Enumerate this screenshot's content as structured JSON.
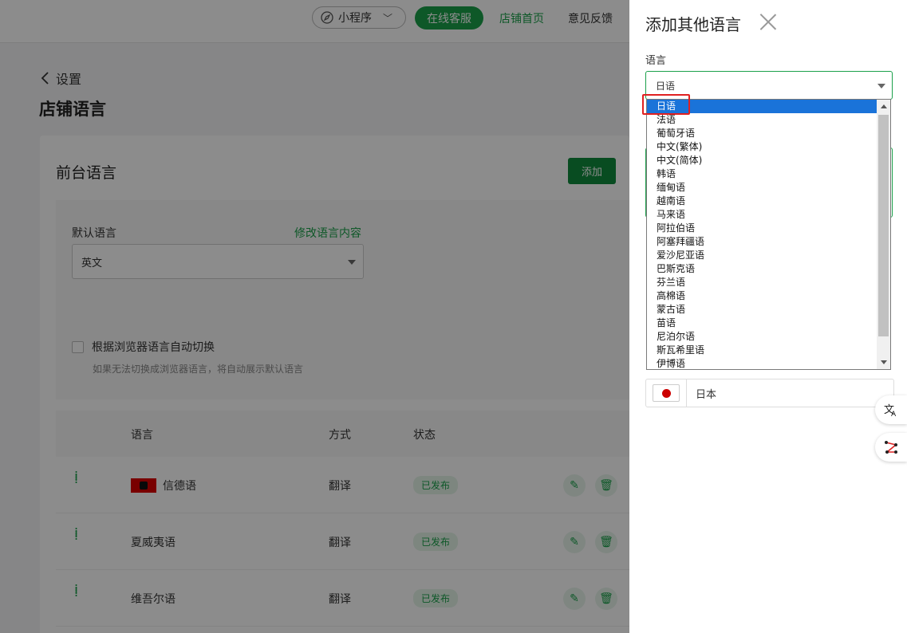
{
  "topbar": {
    "mini_program": "小程序",
    "online_service": "在线客服",
    "store_home": "店铺首页",
    "feedback": "意见反馈"
  },
  "page": {
    "back_label": "设置",
    "title": "店铺语言"
  },
  "frontend": {
    "title": "前台语言",
    "add_button": "添加",
    "default_label": "默认语言",
    "edit_link": "修改语言内容",
    "default_value": "英文",
    "auto_switch_label": "根据浏览器语言自动切换",
    "auto_switch_hint": "如果无法切换成浏览器语言，将自动展示默认语言"
  },
  "table": {
    "headers": {
      "language": "语言",
      "mode": "方式",
      "status": "状态"
    },
    "rows": [
      {
        "name": "信德语",
        "mode": "翻译",
        "status": "已发布",
        "has_flag": true
      },
      {
        "name": "夏威夷语",
        "mode": "翻译",
        "status": "已发布",
        "has_flag": false
      },
      {
        "name": "维吾尔语",
        "mode": "翻译",
        "status": "已发布",
        "has_flag": false
      }
    ]
  },
  "drawer": {
    "title": "添加其他语言",
    "language_label": "语言",
    "selected_language": "日语",
    "flag_name": "日本",
    "options": [
      "日语",
      "法语",
      "葡萄牙语",
      "中文(繁体)",
      "中文(简体)",
      "韩语",
      "缅甸语",
      "越南语",
      "马来语",
      "阿拉伯语",
      "阿塞拜疆语",
      "爱沙尼亚语",
      "巴斯克语",
      "芬兰语",
      "高棉语",
      "蒙古语",
      "苗语",
      "尼泊尔语",
      "斯瓦希里语",
      "伊博语"
    ]
  },
  "colors": {
    "brand_green": "#1aa04a",
    "selection_blue": "#1a73d9",
    "highlight_red": "#e02020"
  }
}
